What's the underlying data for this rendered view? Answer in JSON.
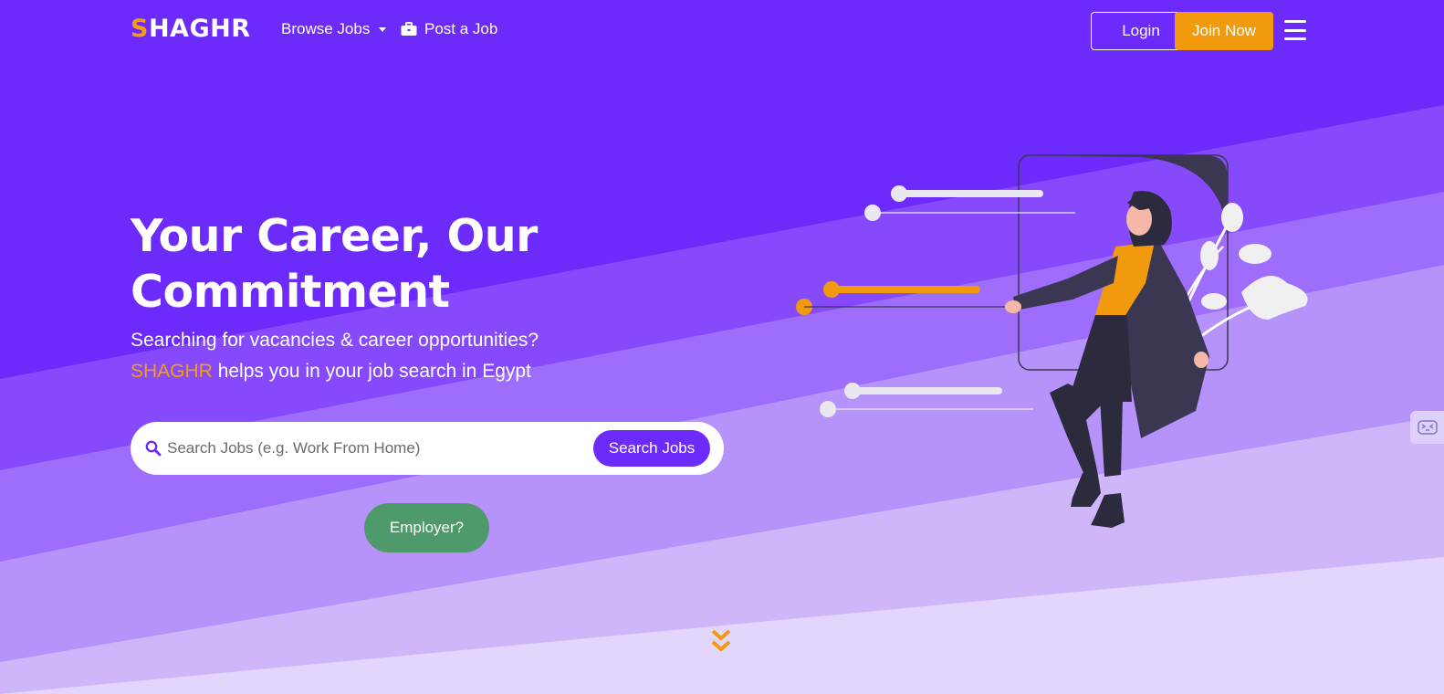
{
  "nav": {
    "logo_first": "S",
    "logo_rest": "HAGHR",
    "browse_label": "Browse Jobs",
    "post_label": "Post a Job",
    "login_label": "Login",
    "join_label": "Join Now"
  },
  "hero": {
    "title_line1": "Your Career, Our",
    "title_line2": "Commitment",
    "subtitle_line1": "Searching for vacancies & career opportunities?",
    "subtitle_brand": "SHAGHR",
    "subtitle_line2_rest": " helps you in your job search in Egypt"
  },
  "search": {
    "placeholder": "Search Jobs (e.g. Work From Home)",
    "button_label": "Search Jobs"
  },
  "employer": {
    "label": "Employer?"
  },
  "colors": {
    "primary": "#6c2bfb",
    "accent": "#f29a0e",
    "employer_green": "#4e9a6a"
  },
  "icons": {
    "nav_post": "briefcase-icon",
    "search": "search-icon",
    "menu": "hamburger-menu-icon",
    "scroll": "chevron-double-down-icon"
  }
}
